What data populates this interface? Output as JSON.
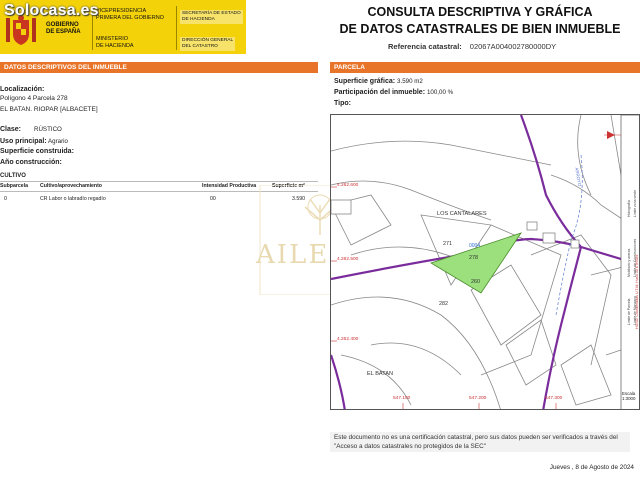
{
  "brand": "Solocasa.es",
  "government": {
    "name": "GOBIERNO\nDE ESPAÑA",
    "vp": "VICEPRESIDENCIA\nPRIMERA DEL GOBIERNO",
    "ministry": "MINISTERIO\nDE HACIENDA",
    "secretary": "SECRETARÍA DE ESTADO\nDE HACIENDA",
    "direction": "DIRECCIÓN GENERAL\nDEL CATASTRO"
  },
  "doc_title": "CONSULTA DESCRIPTIVA Y GRÁFICA\nDE DATOS CATASTRALES DE BIEN INMUEBLE",
  "reference": {
    "label": "Referencia catastral:",
    "value": "02067A004002780000DY"
  },
  "left_section": {
    "title": "DATOS DESCRIPTIVOS DEL INMUEBLE",
    "localizacion_label": "Localización:",
    "localizacion_line1": "Polígono 4 Parcela 278",
    "localizacion_line2": "EL BATAN. RIOPAR [ALBACETE]",
    "clase_label": "Clase:",
    "clase_value": "RÚSTICO",
    "uso_label": "Uso principal:",
    "uso_value": "Agrario",
    "superficie_label": "Superficie construida:",
    "anio_label": "Año construcción:",
    "cultivo_label": "CULTIVO",
    "table": {
      "headers": [
        "Subparcela",
        "Cultivo/aprovechamiento",
        "Intensidad Productiva",
        "Superficie m²"
      ],
      "rows": [
        [
          "0",
          "CR Labor o labradío regadío",
          "00",
          "3.590"
        ]
      ]
    }
  },
  "watermark": "AILESS",
  "right_section": {
    "title": "PARCELA",
    "superficie_label": "Superficie gráfica:",
    "superficie_value": "3.590 m2",
    "participacion_label": "Participación del inmueble:",
    "participacion_value": "100,00 %",
    "tipo_label": "Tipo:"
  },
  "map": {
    "place_labels": [
      "LOS CANTALARES",
      "EL BATAN"
    ],
    "parcel_numbers": [
      "271",
      "278",
      "260",
      "282"
    ],
    "parcel_code": "0004",
    "y_ticks": [
      "4.262.600",
      "4.262.500",
      "4.262.400"
    ],
    "x_ticks": [
      "547.100",
      "547.200",
      "547.300"
    ],
    "road_label": "ARROYO",
    "scale_label": "Escala\n1:3000",
    "side_text": "HUSO: Coordenadas U.T.M. Huso 30 ETRS89",
    "legend_items": [
      "Límite de Manzana",
      "Límite de Parcela",
      "Límite de Construcciones",
      "Mobiliario y aceras",
      "Límite zona verde",
      "Hidrografía"
    ]
  },
  "footer_note": "Este documento no es una certificación catastral, pero sus datos pueden ser verificados a través del \"Acceso a datos catastrales no protegidos de la SEC\"",
  "date": "Jueves , 8 de Agosto de 2024",
  "colors": {
    "orange": "#e8742a",
    "yellow": "#f4d20a",
    "parcel": "#9be07c",
    "road": "#7a2c9c"
  }
}
